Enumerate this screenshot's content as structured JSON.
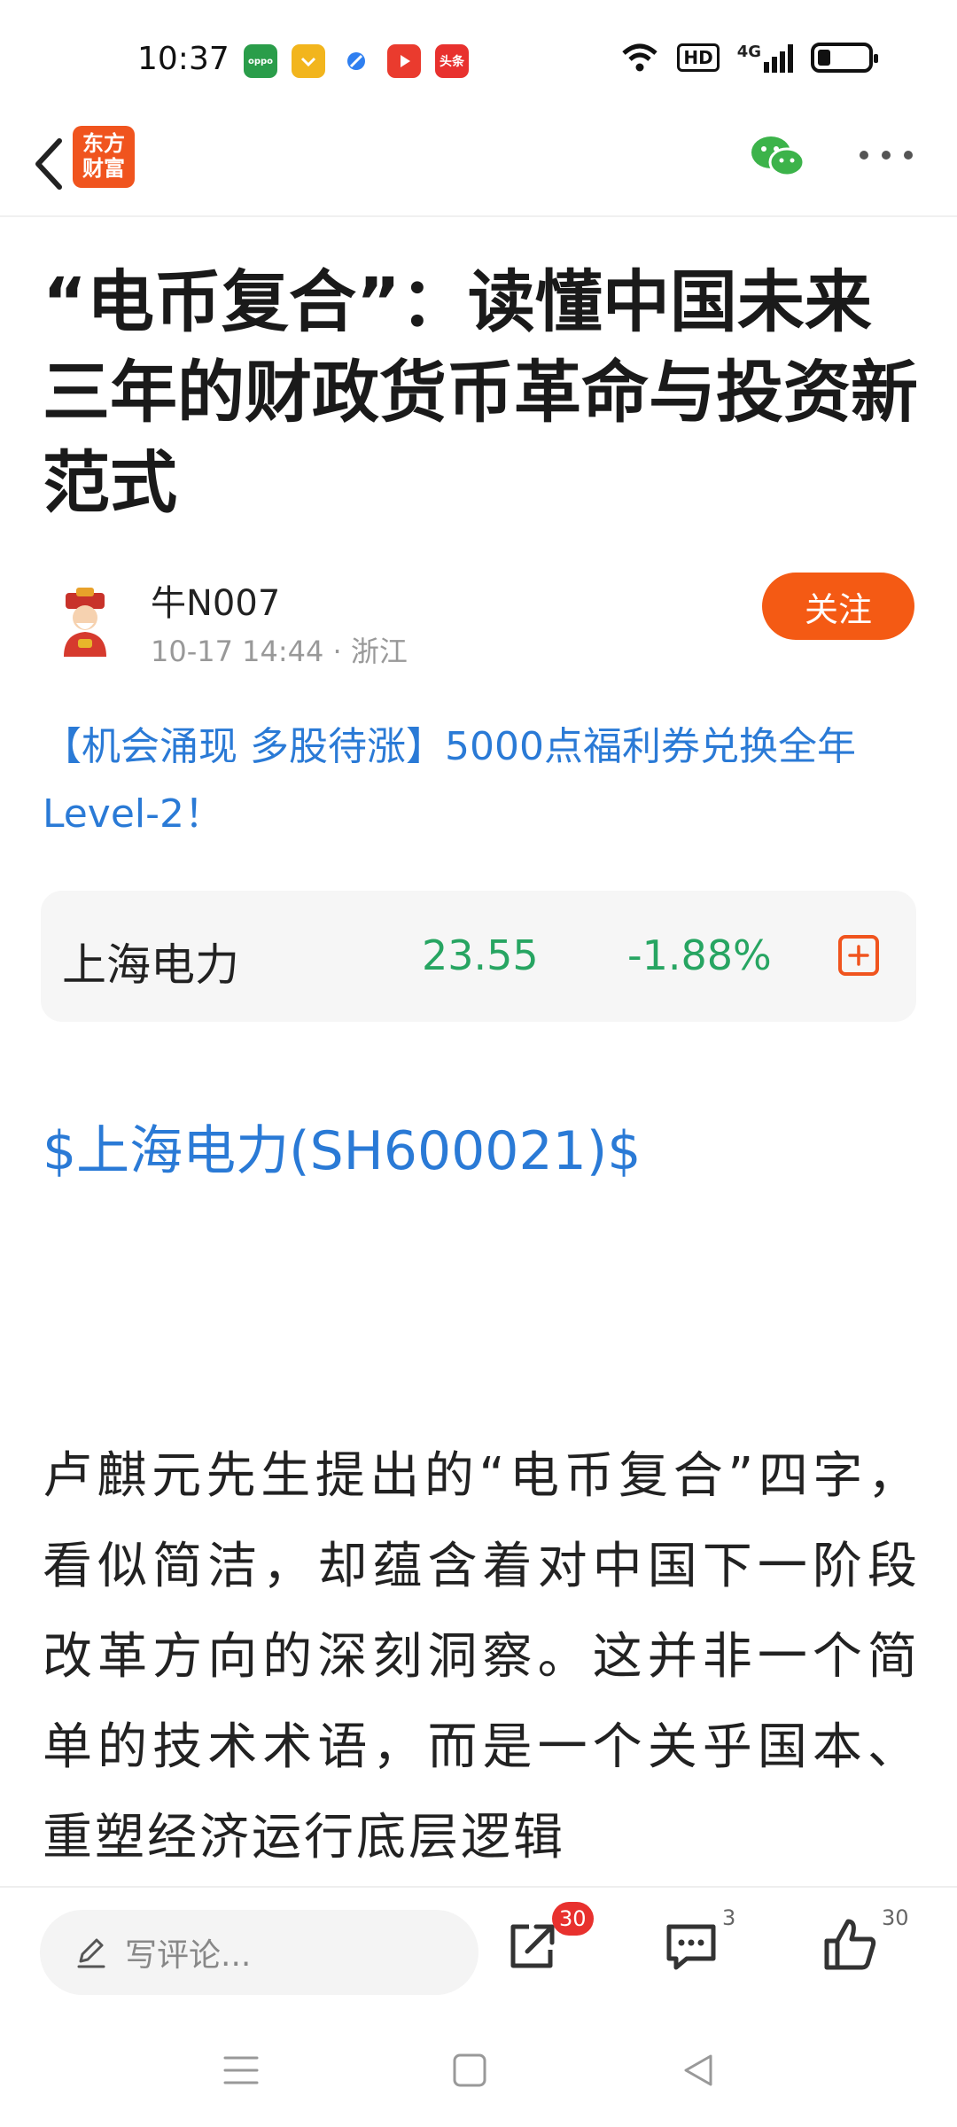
{
  "status_bar": {
    "time": "10:37",
    "app_icons": [
      "oppo-app-icon",
      "coupon-app-icon",
      "browser-app-icon",
      "video-app-icon",
      "toutiao-app-icon"
    ],
    "network": "4G",
    "hd": "HD",
    "battery_level": 0.2
  },
  "nav": {
    "logo_text_1": "东方",
    "logo_text_2": "财富",
    "brand_color": "#f0541e"
  },
  "article": {
    "title": "“电币复合”：读懂中国未来三年的财政货币革命与投资新范式",
    "author": {
      "name": "牛N007",
      "meta": "10-17 14:44 · 浙江",
      "follow_label": "关注"
    },
    "promo": "【机会涌现 多股待涨】5000点福利券兑换全年Level-2！",
    "stock": {
      "name": "上海电力",
      "price": "23.55",
      "change": "-1.88%",
      "price_color": "#27a562"
    },
    "stock_link": "$上海电力(SH600021)$",
    "body": "卢麒元先生提出的“电币复合”四字，看似简洁，却蕴含着对中国下一阶段改革方向的深刻洞察。这并非一个简单的技术术语，而是一个关乎国本、重塑经济运行底层逻辑"
  },
  "actions": {
    "comment_placeholder": "写评论...",
    "share_count": "30",
    "comment_count": "3",
    "like_count": "30"
  }
}
